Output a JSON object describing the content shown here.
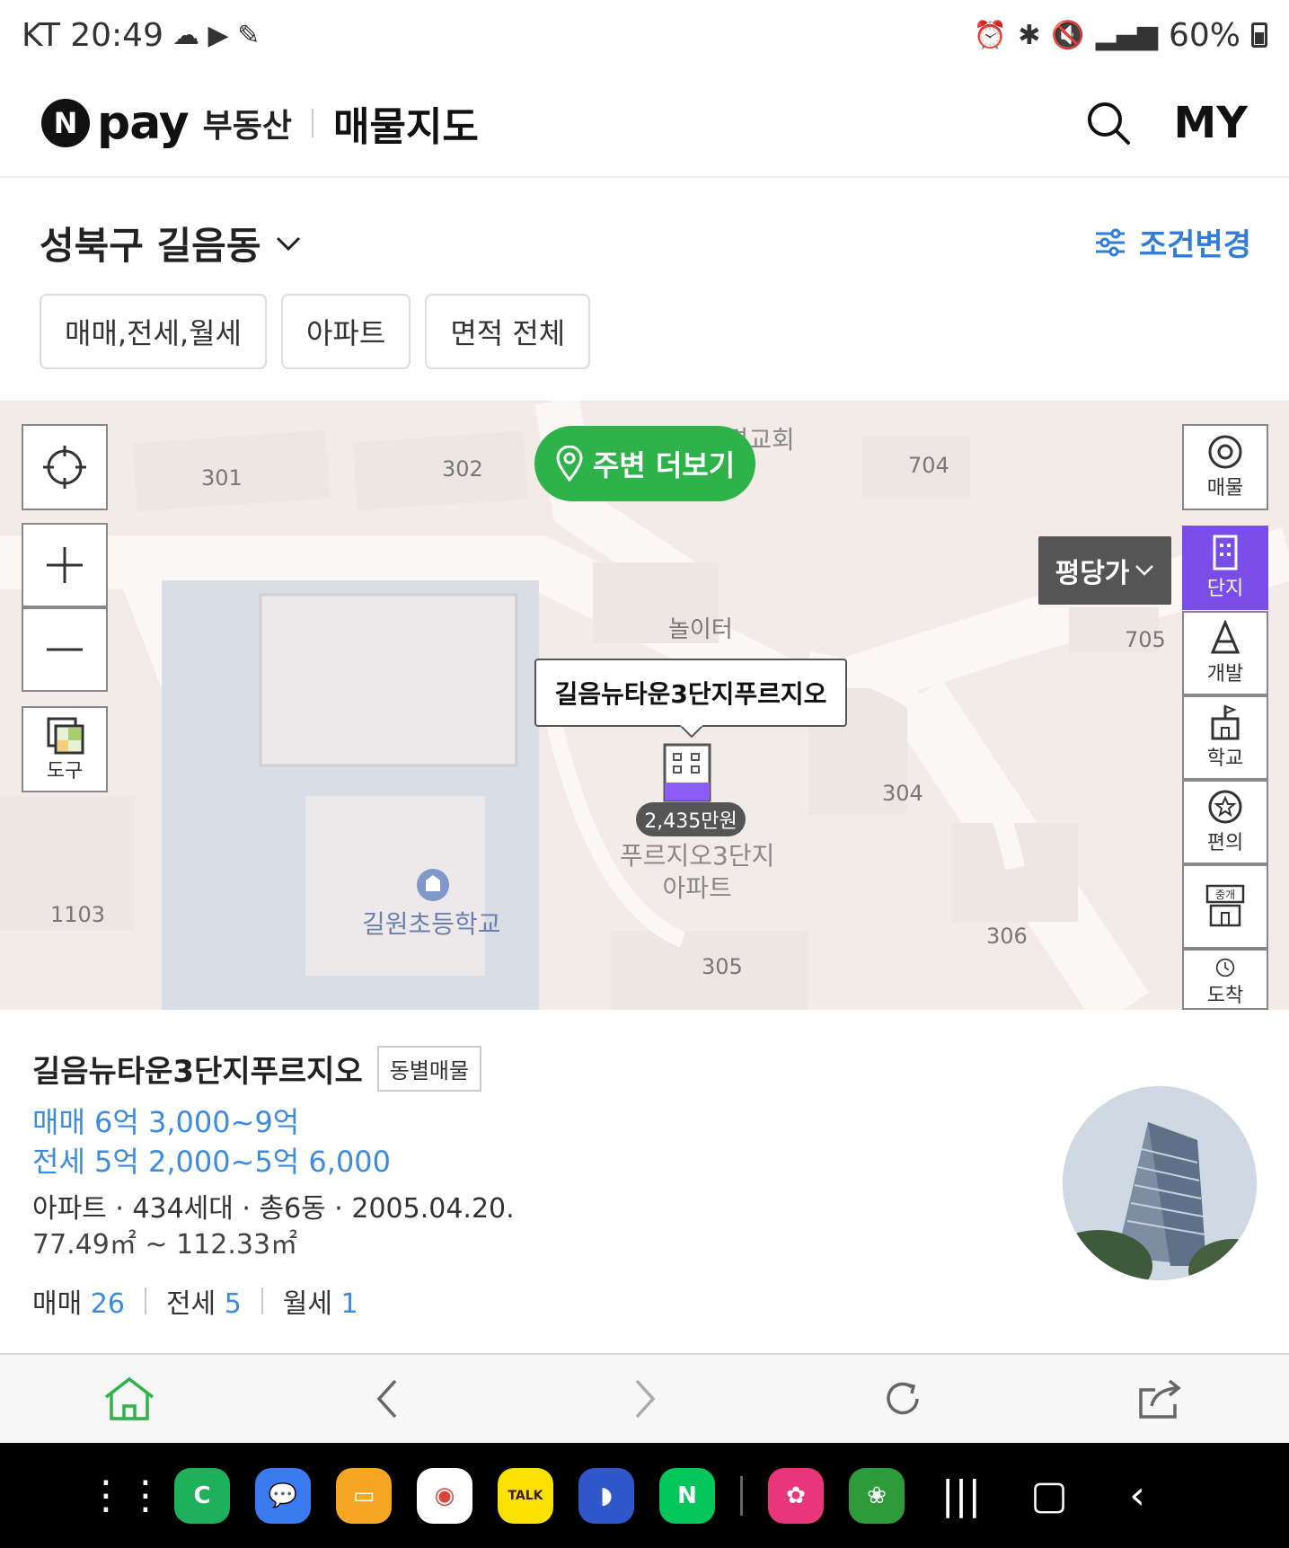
{
  "status": {
    "carrier_time": "KT 20:49",
    "battery": "60%"
  },
  "header": {
    "pay": "pay",
    "realestate": "부동산",
    "map_title": "매물지도",
    "my": "MY"
  },
  "location": {
    "name": "성북구 길음동",
    "condition_label": "조건변경"
  },
  "filters": [
    "매매,전세,월세",
    "아파트",
    "면적 전체"
  ],
  "map": {
    "nearby_button": "주변 더보기",
    "tool_label": "도구",
    "price_mode": "평당가",
    "side_tools": [
      {
        "label": "매물"
      },
      {
        "label": "단지"
      },
      {
        "label": "개발"
      },
      {
        "label": "학교"
      },
      {
        "label": "편의"
      },
      {
        "label": "중개"
      },
      {
        "label": "도착"
      }
    ],
    "complex_tooltip": "길음뉴타운3단지푸르지오",
    "price_badge": "2,435만원",
    "apt_label_line1": "푸르지오3단지",
    "apt_label_line2": "아파트",
    "school": "길원초등학교",
    "playground": "놀이터",
    "church": "새생명교회",
    "building_numbers": [
      "301",
      "302",
      "704",
      "705",
      "304",
      "305",
      "306",
      "1103"
    ]
  },
  "info": {
    "title": "길음뉴타운3단지푸르지오",
    "tag": "동별매물",
    "sale_price": "매매 6억 3,000~9억",
    "jeonse_price": "전세 5억 2,000~5억 6,000",
    "meta_line1": "아파트 · 434세대 · 총6동 · 2005.04.20.",
    "meta_line2": "77.49㎡ ~ 112.33㎡",
    "counts": [
      {
        "label": "매매",
        "value": "26"
      },
      {
        "label": "전세",
        "value": "5"
      },
      {
        "label": "월세",
        "value": "1"
      }
    ]
  },
  "colors": {
    "accent_blue": "#3d8be0",
    "nearby_green": "#2db34a",
    "complex_purple": "#7b4de8"
  }
}
